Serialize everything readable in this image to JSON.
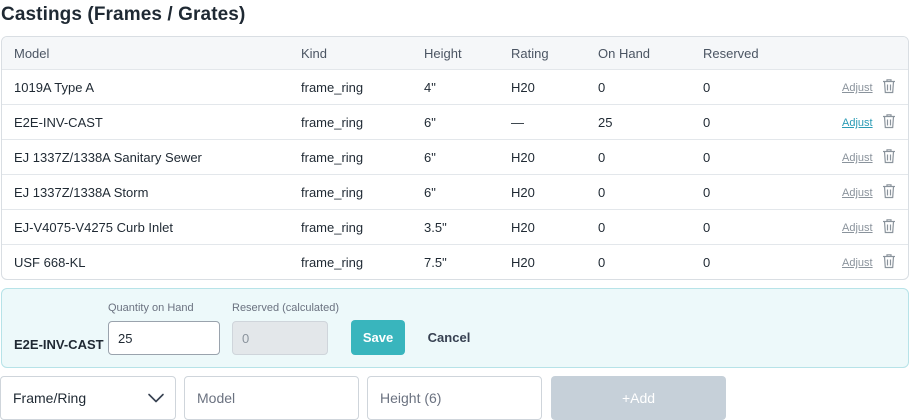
{
  "page": {
    "title": "Castings (Frames / Grates)"
  },
  "table": {
    "columns": {
      "model": "Model",
      "kind": "Kind",
      "height": "Height",
      "rating": "Rating",
      "on_hand": "On Hand",
      "reserved": "Reserved"
    },
    "rows": [
      {
        "model": "1019A Type A",
        "kind": "frame_ring",
        "height": "4\"",
        "rating": "H20",
        "on_hand": "0",
        "reserved": "0",
        "action": "Adjust"
      },
      {
        "model": "E2E-INV-CAST",
        "kind": "frame_ring",
        "height": "6\"",
        "rating": "—",
        "on_hand": "25",
        "reserved": "0",
        "action": "Adjust"
      },
      {
        "model": "EJ 1337Z/1338A Sanitary Sewer",
        "kind": "frame_ring",
        "height": "6\"",
        "rating": "H20",
        "on_hand": "0",
        "reserved": "0",
        "action": "Adjust"
      },
      {
        "model": "EJ 1337Z/1338A Storm",
        "kind": "frame_ring",
        "height": "6\"",
        "rating": "H20",
        "on_hand": "0",
        "reserved": "0",
        "action": "Adjust"
      },
      {
        "model": "EJ-V4075-V4275 Curb Inlet",
        "kind": "frame_ring",
        "height": "3.5\"",
        "rating": "H20",
        "on_hand": "0",
        "reserved": "0",
        "action": "Adjust"
      },
      {
        "model": "USF 668-KL",
        "kind": "frame_ring",
        "height": "7.5\"",
        "rating": "H20",
        "on_hand": "0",
        "reserved": "0",
        "action": "Adjust"
      }
    ],
    "active_row_index": 1,
    "row_icon": "trash-icon"
  },
  "edit_panel": {
    "model": "E2E-INV-CAST",
    "qty_label": "Quantity on Hand",
    "qty_value": "25",
    "reserved_label": "Reserved (calculated)",
    "reserved_value": "0",
    "save_label": "Save",
    "cancel_label": "Cancel"
  },
  "add_form": {
    "kind_selected": "Frame/Ring",
    "model_placeholder": "Model",
    "height_placeholder": "Height (6)",
    "add_label": "Add",
    "add_icon": "plus-icon"
  },
  "colors": {
    "accent": "#39b5bd",
    "panel_bg": "#edf9fa",
    "disabled_button": "#c6d0d9",
    "active_link": "#2a9bb5"
  }
}
